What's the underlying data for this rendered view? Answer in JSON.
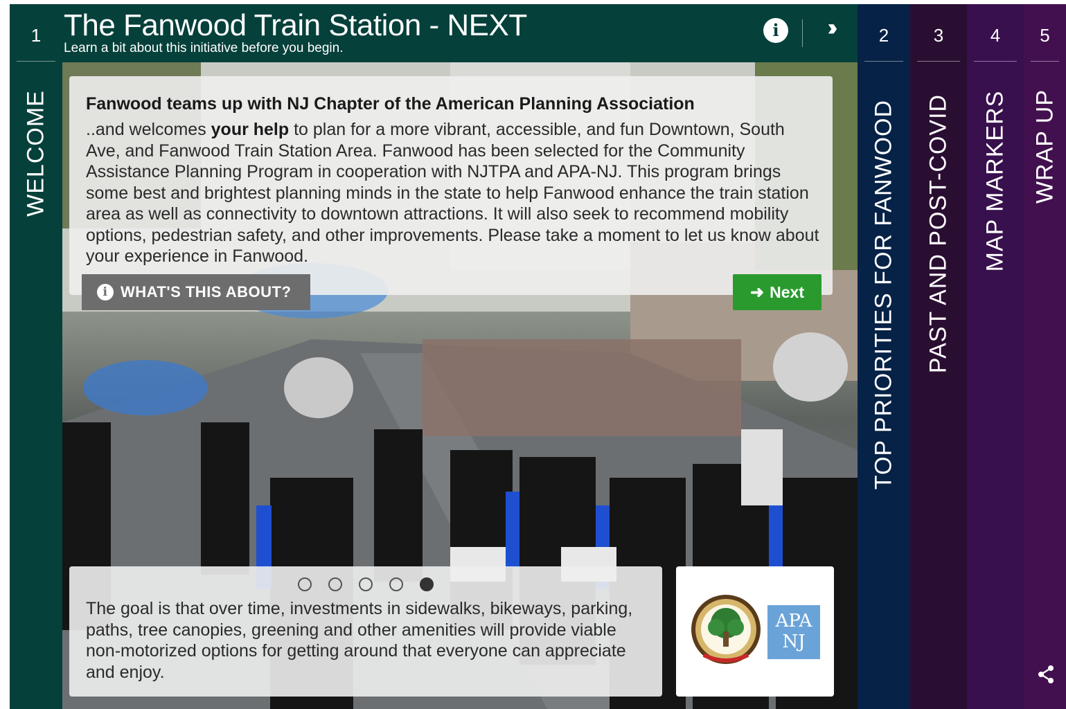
{
  "header": {
    "title": "The Fanwood Train Station - NEXT",
    "subtitle": "Learn a bit about this initiative before you begin.",
    "info_icon": "info-icon",
    "collapse_icon": "double-chevron-right-icon"
  },
  "sections": [
    {
      "number": "1",
      "title": "WELCOME",
      "color": "#06403b"
    },
    {
      "number": "2",
      "title": "TOP PRIORITIES FOR FANWOOD",
      "color": "#062246"
    },
    {
      "number": "3",
      "title": "PAST AND POST-COVID",
      "color": "#2a0e32"
    },
    {
      "number": "4",
      "title": "MAP MARKERS",
      "color": "#38104e"
    },
    {
      "number": "5",
      "title": "WRAP UP",
      "color": "#42104f"
    }
  ],
  "intro": {
    "heading": "Fanwood teams up with NJ Chapter of the American Planning Association",
    "body_start": "..and welcomes ",
    "body_bold": "your help",
    "body_rest": " to plan for a more vibrant, accessible, and fun Downtown, South Ave, and Fanwood Train Station Area. Fanwood has been selected for the Community Assistance Planning Program in cooperation with NJTPA and APA-NJ. This program brings some best and brightest planning minds in the state to help Fanwood enhance the train station area as well as connectivity to downtown attractions. It will also seek to recommend mobility options, pedestrian safety, and other improvements. Please take a moment to let us know about your experience in Fanwood."
  },
  "buttons": {
    "whats_this": "WHAT'S THIS ABOUT?",
    "next": "Next"
  },
  "carousel": {
    "slide_count": 5,
    "active_slide": 5
  },
  "goal": {
    "text": "The goal is that over time, investments in sidewalks, bikeways, parking, paths, tree canopies, greening and other amenities will provide viable non-motorized options for getting around that everyone can appreciate and enjoy."
  },
  "logos": {
    "apa_line1": "APA",
    "apa_line2": "NJ",
    "apa_color": "#6aa3d8"
  },
  "share": {
    "icon": "share-icon"
  },
  "colors": {
    "next_button": "#2a9a2f",
    "whats_button": "#6d6d6d"
  }
}
